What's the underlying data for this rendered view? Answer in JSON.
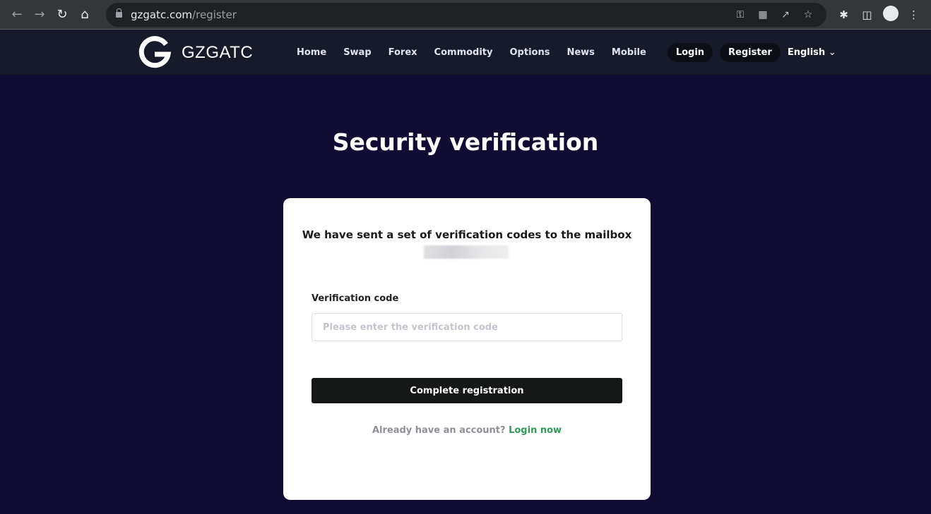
{
  "browser": {
    "url_host": "gzgatc.com",
    "url_path": "/register"
  },
  "site": {
    "brand": "GZGATC",
    "brand_color": "#ffffff",
    "nav": [
      "Home",
      "Swap",
      "Forex",
      "Commodity",
      "Options",
      "News",
      "Mobile"
    ],
    "login": "Login",
    "register": "Register",
    "language": "English"
  },
  "page": {
    "title": "Security verification",
    "message": "We have sent a set of verification codes to the mailbox",
    "code_label": "Verification code",
    "code_placeholder": "Please enter the verification code",
    "code_value": "",
    "submit": "Complete registration",
    "footer_text": "Already have an account?",
    "footer_link": "Login now",
    "link_color": "#2e9b58"
  }
}
